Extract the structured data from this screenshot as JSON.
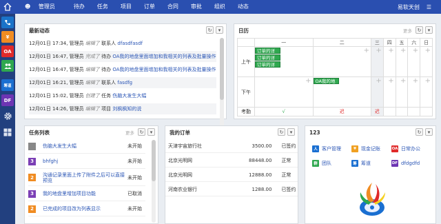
{
  "topbar": {
    "user": "管理员",
    "nav": [
      "待办",
      "任务",
      "项目",
      "订单",
      "合同",
      "审批",
      "组织",
      "动态"
    ],
    "right_user": "易软天创",
    "bg": "#2a4fb0"
  },
  "leftbar": {
    "items": [
      {
        "icon": "phone-icon",
        "label": "",
        "color": "#1a73c9"
      },
      {
        "icon": "yen-icon",
        "label": "¥",
        "color": "#f08c22"
      },
      {
        "icon": "oa-icon",
        "label": "OA",
        "color": "#e02a2a"
      },
      {
        "icon": "team-icon",
        "label": "",
        "color": "#2fa84f"
      },
      {
        "icon": "book-icon",
        "label": "筹道",
        "color": "#1a6fd1"
      },
      {
        "icon": "df-icon",
        "label": "DF",
        "color": "#6d35b3"
      },
      {
        "icon": "gear-icon",
        "label": "",
        "color": "#22407f"
      },
      {
        "icon": "grid-icon",
        "label": "",
        "color": "#22407f"
      }
    ]
  },
  "feed": {
    "title": "最新动态",
    "rows": [
      {
        "time": "12月01日 17:34",
        "user": "管理员",
        "action": "编辑了",
        "type": "联系人",
        "object": "dfasdfasdf"
      },
      {
        "time": "12月01日 16:47",
        "user": "管理员",
        "action": "完成了",
        "type": "待办",
        "object": "OA我的地盘里面增加和我相关的列表及批量操作"
      },
      {
        "time": "12月01日 16:47",
        "user": "管理员",
        "action": "编辑了",
        "type": "待办",
        "object": "OA我的地盘里面增加和我相关的列表及批量操作"
      },
      {
        "time": "12月01日 16:21",
        "user": "管理员",
        "action": "编辑了",
        "type": "联系人",
        "object": "fasdfg"
      },
      {
        "time": "12月01日 15:02",
        "user": "管理员",
        "action": "创建了",
        "type": "任务",
        "object": "伤脑大发生大幅"
      },
      {
        "time": "12月01日 14:26",
        "user": "管理员",
        "action": "编辑了",
        "type": "项目",
        "object": "刘枫枫知的说"
      }
    ]
  },
  "calendar": {
    "title": "日历",
    "more": "更多",
    "days": [
      "一",
      "二",
      "三",
      "四",
      "五",
      "六",
      "日"
    ],
    "am": "上午",
    "pm": "下午",
    "attendance": "考勤",
    "am_events": [
      "订单的详",
      "订单的详",
      "订单的详"
    ],
    "pm_event": "OA我的地",
    "attend_values": [
      "√",
      "迟",
      "迟"
    ]
  },
  "tasks": {
    "title": "任务列表",
    "more": "更多",
    "rows": [
      {
        "num": "",
        "color": "#888888",
        "title": "伤脑大发生大幅",
        "status": "未开始"
      },
      {
        "num": "3",
        "color": "#7b3fb5",
        "title": "bhfghj",
        "status": "未开始"
      },
      {
        "num": "2",
        "color": "#f08c22",
        "title": "沟通记录里面上传了附件之后可以直接预览",
        "status": "未开始"
      },
      {
        "num": "3",
        "color": "#7b3fb5",
        "title": "我的地盘里增加项目功能",
        "status": "已取消"
      },
      {
        "num": "2",
        "color": "#f08c22",
        "title": "已完成的项目改为列表显示",
        "status": "未开始"
      }
    ]
  },
  "orders": {
    "title": "我的订单",
    "rows": [
      {
        "name": "天津宇宙旅行社",
        "amount": "3500.00",
        "status": "已签约"
      },
      {
        "name": "北京光明网",
        "amount": "88448.00",
        "status": "正常"
      },
      {
        "name": "北京光明网",
        "amount": "12888.00",
        "status": "正常"
      },
      {
        "name": "河南农业银行",
        "amount": "1288.00",
        "status": "已签约"
      }
    ]
  },
  "apps": {
    "title": "123",
    "items": [
      {
        "icon": "contacts-icon",
        "glyph": "人",
        "color": "#1a6fd1",
        "label": "客户管理"
      },
      {
        "icon": "yen-icon",
        "glyph": "¥",
        "color": "#f0a022",
        "label": "现金记账"
      },
      {
        "icon": "oa-icon",
        "glyph": "OA",
        "color": "#e02a2a",
        "label": "日常办公"
      },
      {
        "icon": "team-icon",
        "glyph": "群",
        "color": "#2fa84f",
        "label": "团队"
      },
      {
        "icon": "book-icon",
        "glyph": "筹",
        "color": "#1a6fd1",
        "label": "筹道"
      },
      {
        "icon": "df-icon",
        "glyph": "DF",
        "color": "#6d35b3",
        "label": "dfdgdfd"
      }
    ]
  }
}
